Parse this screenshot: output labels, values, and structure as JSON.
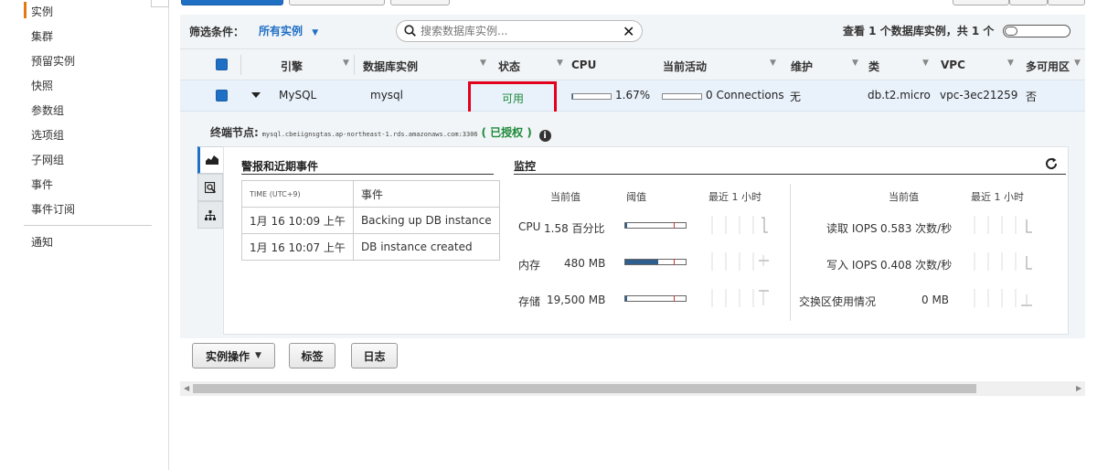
{
  "sidebar": {
    "items": [
      {
        "label": "实例"
      },
      {
        "label": "集群"
      },
      {
        "label": "预留实例"
      },
      {
        "label": "快照"
      },
      {
        "label": "参数组"
      },
      {
        "label": "选项组"
      },
      {
        "label": "子网组"
      },
      {
        "label": "事件"
      },
      {
        "label": "事件订阅"
      },
      {
        "label": "通知"
      }
    ]
  },
  "filter": {
    "label": "筛选条件：",
    "value": "所有实例",
    "search_placeholder": "搜索数据库实例...",
    "result_text": "查看 1 个数据库实例，共 1 个"
  },
  "table": {
    "columns": [
      "引擎",
      "数据库实例",
      "状态",
      "CPU",
      "当前活动",
      "维护",
      "类",
      "VPC",
      "多可用区"
    ],
    "row": {
      "engine": "MySQL",
      "instance": "mysql",
      "status": "可用",
      "cpu": "1.67%",
      "cpu_fraction": 0.0167,
      "activity": "0 Connections",
      "maintenance": "无",
      "class": "db.t2.micro",
      "vpc": "vpc-3ec21259",
      "multi_az": "否"
    }
  },
  "detail": {
    "endpoint_label": "终端节点:",
    "endpoint_host": "mysql.cbeiignsgtas.ap-northeast-1.rds.amazonaws.com:3306",
    "auth_text": "( 已授权 )",
    "alerts_title": "警报和近期事件",
    "events_header_time": "TIME (UTC+9)",
    "events_header_event": "事件",
    "events": [
      {
        "time": "1月 16 10:09 上午",
        "event": "Backing up DB instance"
      },
      {
        "time": "1月 16 10:07 上午",
        "event": "DB instance created"
      }
    ],
    "monitoring_title": "监控",
    "mon_headers": {
      "current": "当前值",
      "threshold": "阈值",
      "last_hour": "最近 1 小时"
    },
    "left_metrics": [
      {
        "name": "CPU",
        "value": "1.58 百分比",
        "fill": 0.02
      },
      {
        "name": "内存",
        "value": "480 MB",
        "fill": 0.55
      },
      {
        "name": "存储",
        "value": "19,500 MB",
        "fill": 0.03
      }
    ],
    "right_metrics": [
      {
        "name": "读取 IOPS",
        "value": "0.583 次数/秒"
      },
      {
        "name": "写入 IOPS",
        "value": "0.408 次数/秒"
      },
      {
        "name": "交换区使用情况",
        "value": "0 MB"
      }
    ]
  },
  "actions": {
    "instance_actions": "实例操作",
    "tags": "标签",
    "logs": "日志"
  },
  "colors": {
    "accent": "#1f6fc5",
    "status_ok": "#1e8a3a",
    "highlight_box": "#e3001b",
    "active_nav": "#e47911"
  }
}
